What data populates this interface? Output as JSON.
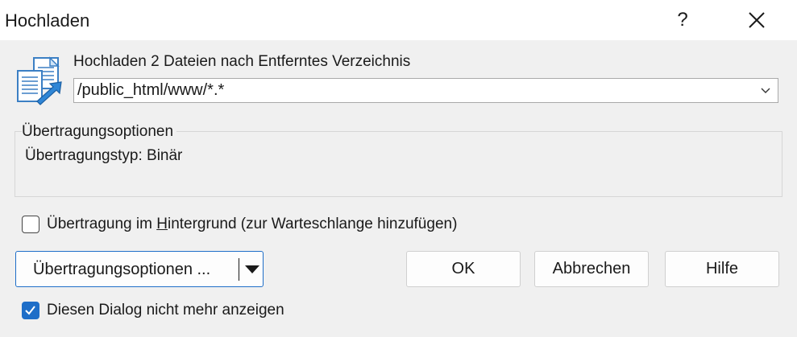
{
  "window": {
    "title": "Hochladen",
    "help_glyph": "?",
    "close_glyph": "✕"
  },
  "header": {
    "label": "Hochladen 2 Dateien nach Entferntes Verzeichnis",
    "icon": "upload-files-icon"
  },
  "remote_path": {
    "value": "/public_html/www/*.*"
  },
  "transfer_group": {
    "caption": "Übertragungsoptionen",
    "type_line": "Übertragungstyp: Binär"
  },
  "background_checkbox": {
    "checked": false,
    "label_before": "Übertragung im ",
    "label_accel": "H",
    "label_after": "intergrund (zur Warteschlange hinzufügen)"
  },
  "buttons": {
    "options_before": "Übertra",
    "options_accel": "g",
    "options_after": "ungsoptionen ...",
    "ok": "OK",
    "cancel": "Abbrechen",
    "help": "Hilfe"
  },
  "dont_show_checkbox": {
    "checked": true,
    "label": "Diesen Dialog nicht mehr anzeigen"
  },
  "colors": {
    "accent": "#1e6ec8",
    "dialog_bg": "#f0f0f0",
    "titlebar_bg": "#ffffff"
  }
}
